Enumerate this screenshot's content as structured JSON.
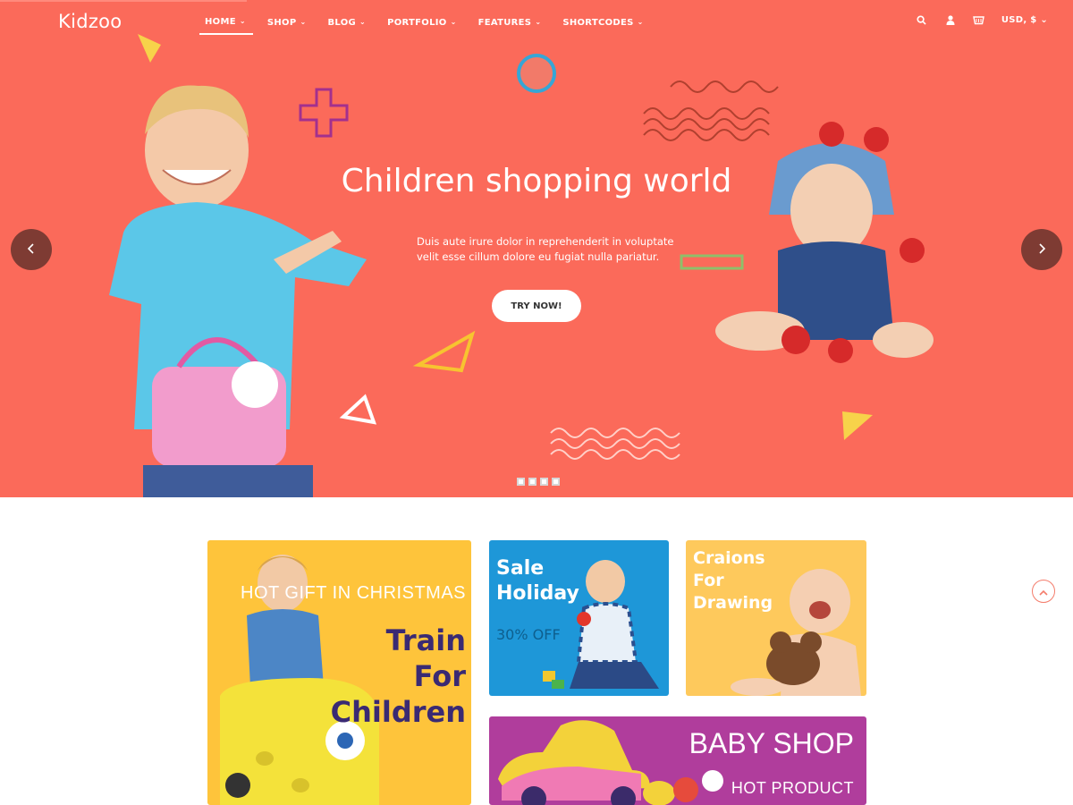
{
  "brand": {
    "logo_text": "Kidzoo",
    "accent": "#fb6a5a"
  },
  "nav": {
    "items": [
      {
        "label": "HOME",
        "active": true
      },
      {
        "label": "SHOP",
        "active": false
      },
      {
        "label": "BLOG",
        "active": false
      },
      {
        "label": "PORTFOLIO",
        "active": false
      },
      {
        "label": "FEATURES",
        "active": false
      },
      {
        "label": "SHORTCODES",
        "active": false
      }
    ],
    "currency_label": "USD, $",
    "icons": [
      "search-icon",
      "user-icon",
      "cart-icon"
    ]
  },
  "hero": {
    "title": "Children shopping world",
    "text": "Duis aute irure dolor in reprehenderit in voluptate velit esse cillum dolore eu fugiat nulla pariatur.",
    "button_label": "TRY NOW!",
    "slide_count": 4,
    "background": "#fb6a5a"
  },
  "banners": {
    "train": {
      "subtitle": "HOT GIFT IN CHRISTMAS",
      "title_lines": [
        "Train",
        "For",
        "Children"
      ],
      "background": "#fec43b"
    },
    "sale": {
      "title_lines": [
        "Sale",
        "Holiday"
      ],
      "subtitle": "30% OFF",
      "background": "#1e97d8"
    },
    "crayons": {
      "title_lines": [
        "Craions",
        "For",
        "Drawing"
      ],
      "background": "#fec95c"
    },
    "baby": {
      "title": "BABY SHOP",
      "subtitle": "HOT PRODUCT",
      "background": "#b03d9c"
    }
  }
}
